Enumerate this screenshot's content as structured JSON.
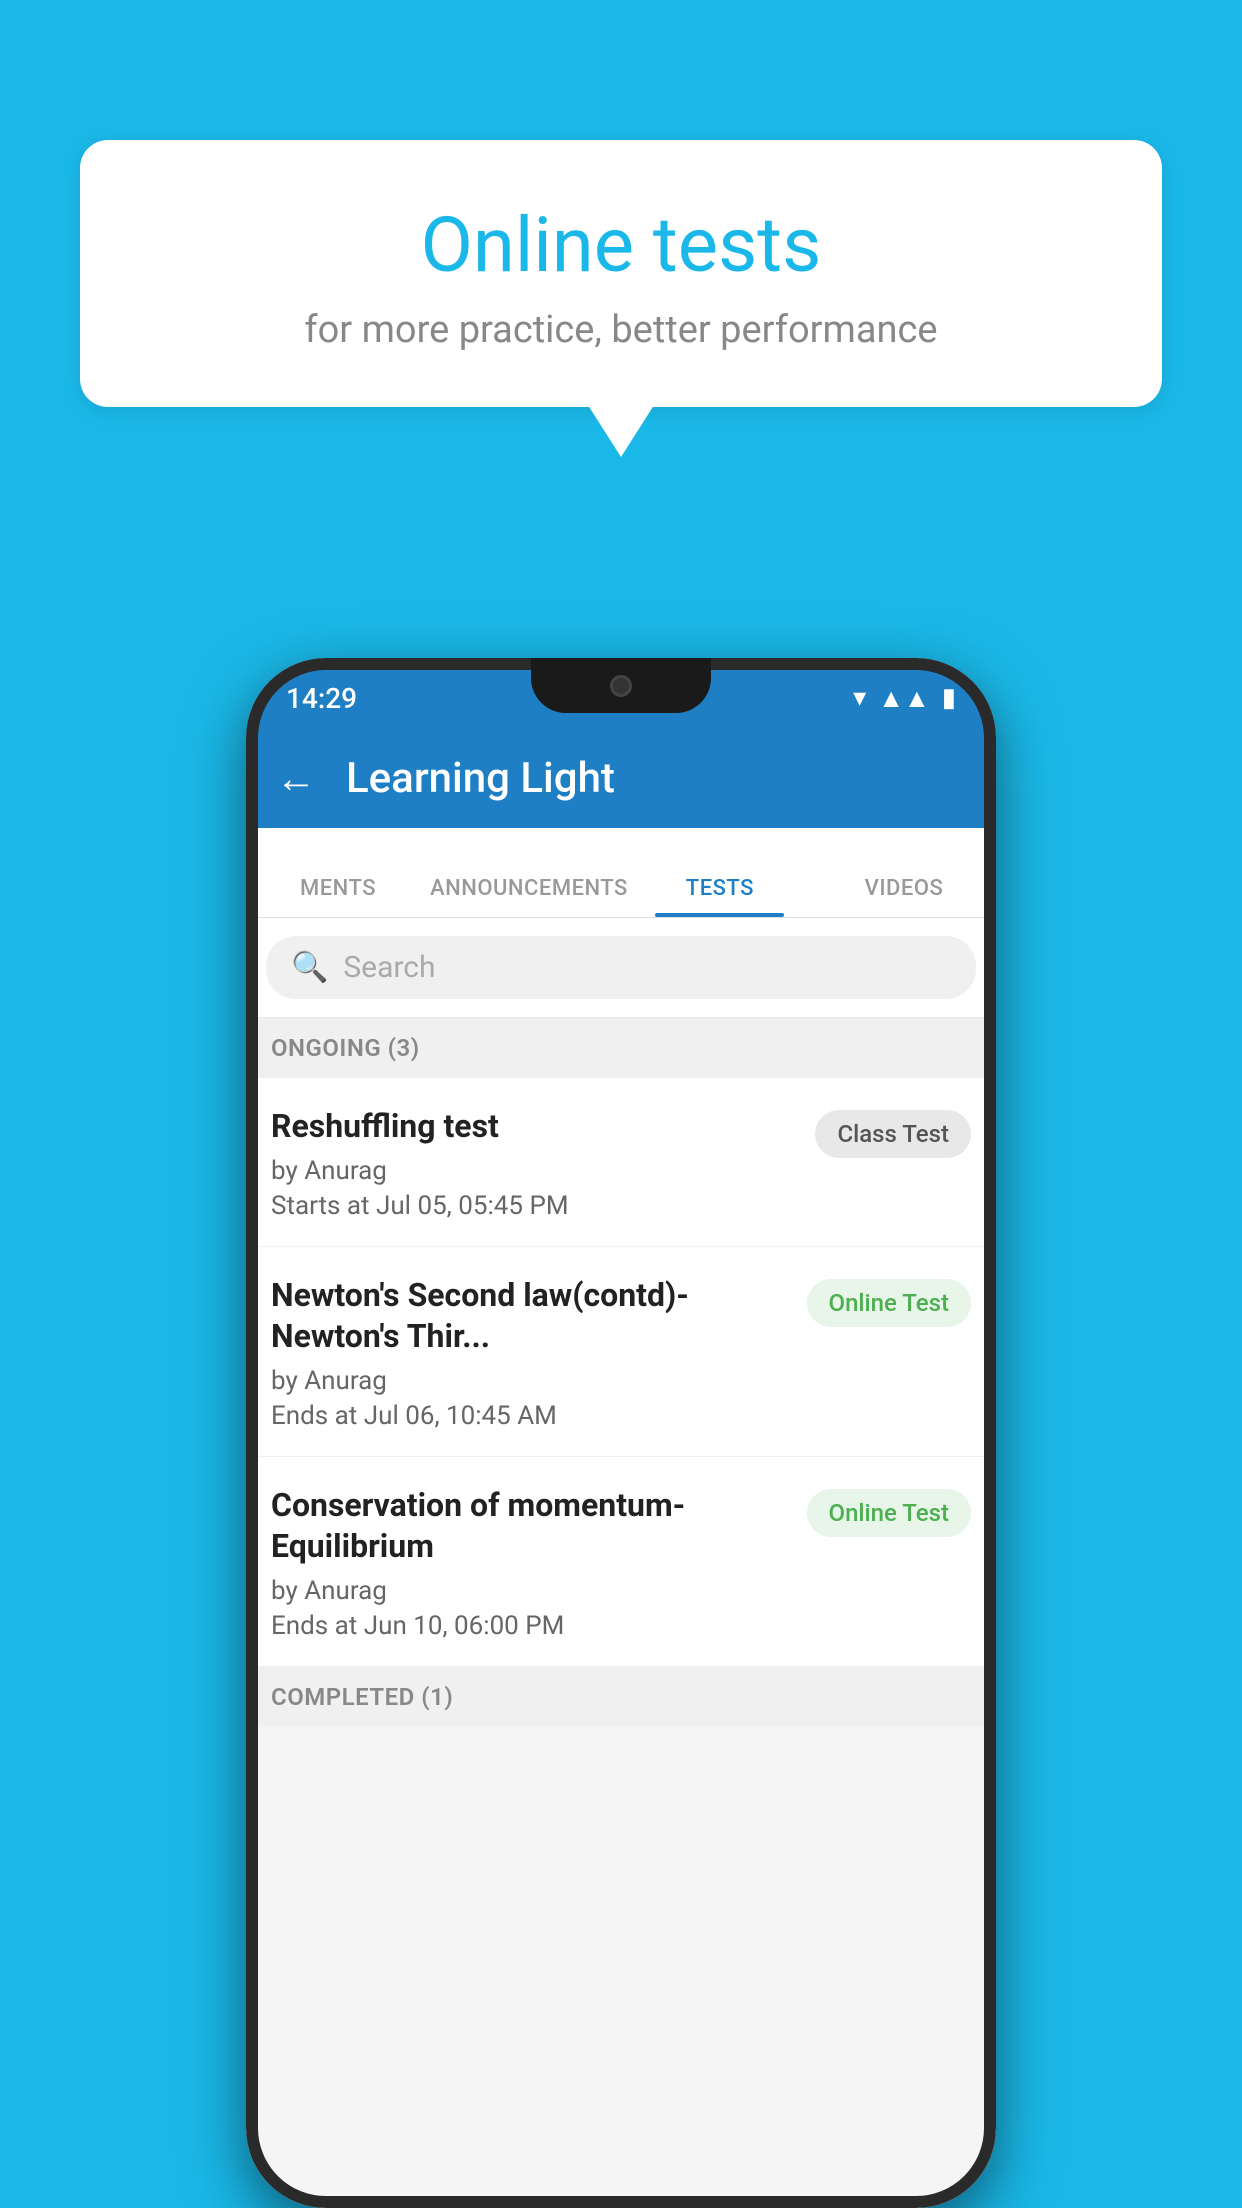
{
  "background_color": "#1ab8e8",
  "bubble": {
    "title": "Online tests",
    "subtitle": "for more practice, better performance"
  },
  "phone": {
    "status_bar": {
      "time": "14:29",
      "icons": [
        "wifi",
        "signal",
        "battery"
      ]
    },
    "header": {
      "title": "Learning Light",
      "back_label": "←"
    },
    "tabs": [
      {
        "label": "MENTS",
        "active": false
      },
      {
        "label": "ANNOUNCEMENTS",
        "active": false
      },
      {
        "label": "TESTS",
        "active": true
      },
      {
        "label": "VIDEOS",
        "active": false
      }
    ],
    "search": {
      "placeholder": "Search"
    },
    "sections": [
      {
        "label": "ONGOING (3)",
        "tests": [
          {
            "name": "Reshuffling test",
            "author": "by Anurag",
            "date": "Starts at  Jul 05, 05:45 PM",
            "badge": "Class Test",
            "badge_type": "class"
          },
          {
            "name": "Newton's Second law(contd)-Newton's Thir...",
            "author": "by Anurag",
            "date": "Ends at  Jul 06, 10:45 AM",
            "badge": "Online Test",
            "badge_type": "online"
          },
          {
            "name": "Conservation of momentum-Equilibrium",
            "author": "by Anurag",
            "date": "Ends at  Jun 10, 06:00 PM",
            "badge": "Online Test",
            "badge_type": "online"
          }
        ]
      },
      {
        "label": "COMPLETED (1)",
        "tests": []
      }
    ]
  }
}
